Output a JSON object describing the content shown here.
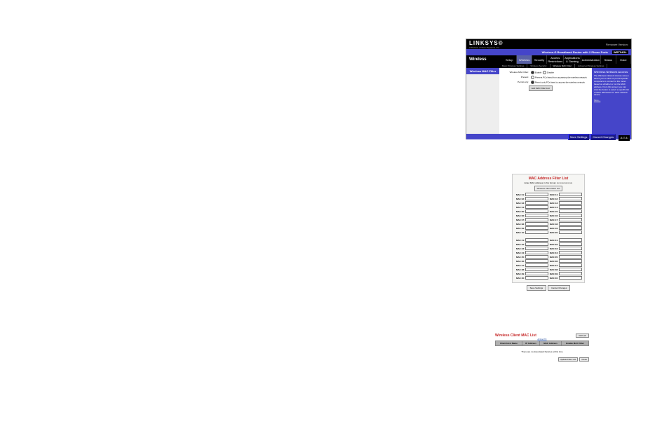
{
  "fig1": {
    "logo": "LINKSYS®",
    "tagline": "A Division of Cisco Systems, Inc.",
    "firmware": "Firmware Version:",
    "router_name": "Wireless-G Broadband Router with 2 Phone Ports",
    "model": "WRT54GL",
    "section": "Wireless",
    "tabs": [
      "Setup",
      "Wireless",
      "Security",
      "Access Restrictions",
      "Applications & Gaming",
      "Administration",
      "Status",
      "Voice"
    ],
    "subtabs": [
      "Basic Wireless Settings",
      "Wireless Security",
      "Wireless MAC Filter",
      "Advanced Wireless Settings"
    ],
    "side_label": "Wireless MAC Filter",
    "row_filter": {
      "label": "Wireless MAC Filter:",
      "opt1": "Enable",
      "opt2": "Disable"
    },
    "row_prevent": {
      "label": "Prevent:",
      "text": "Prevent PCs listed from accessing the wireless network"
    },
    "row_permit": {
      "label": "Permit only:",
      "text": "Permit only PCs listed to access the wireless network"
    },
    "edit_btn": "Edit MAC Filter List",
    "help": {
      "title": "Wireless Network Access",
      "body": "The Wireless Network Access screen allows you to block or permit specific computers to connect to the router based on whether or not the MAC address. From this screen you can click the button to select a specific list of MAC addresses for each network device.",
      "more": "More..."
    },
    "save": "Save Settings",
    "cancel": "Cancel Changes"
  },
  "fig2": {
    "title": "MAC Address Filter List",
    "sub": "Enter MAC Address in this format: xx:xx:xx:xx:xx:xx",
    "wcl": "Wireless Client MAC List",
    "block1": [
      [
        "MAC 01:",
        "MAC 11:"
      ],
      [
        "MAC 02:",
        "MAC 12:"
      ],
      [
        "MAC 03:",
        "MAC 13:"
      ],
      [
        "MAC 04:",
        "MAC 14:"
      ],
      [
        "MAC 05:",
        "MAC 15:"
      ],
      [
        "MAC 06:",
        "MAC 16:"
      ],
      [
        "MAC 07:",
        "MAC 17:"
      ],
      [
        "MAC 08:",
        "MAC 18:"
      ],
      [
        "MAC 09:",
        "MAC 19:"
      ],
      [
        "MAC 10:",
        "MAC 20:"
      ]
    ],
    "block2": [
      [
        "MAC 21:",
        "MAC 31:"
      ],
      [
        "MAC 22:",
        "MAC 32:"
      ],
      [
        "MAC 23:",
        "MAC 33:"
      ],
      [
        "MAC 24:",
        "MAC 34:"
      ],
      [
        "MAC 25:",
        "MAC 35:"
      ],
      [
        "MAC 26:",
        "MAC 36:"
      ],
      [
        "MAC 27:",
        "MAC 37:"
      ],
      [
        "MAC 28:",
        "MAC 38:"
      ],
      [
        "MAC 29:",
        "MAC 39:"
      ],
      [
        "MAC 30:",
        "MAC 40:"
      ]
    ],
    "save": "Save Settings",
    "cancel": "Cancel Changes"
  },
  "fig3": {
    "title": "Wireless Client MAC List",
    "refresh": "Refresh",
    "active": "Active PC",
    "cols": [
      "Client Host Name",
      "IP Address",
      "MAC Address",
      "Enable MAC Filter"
    ],
    "msg": "There are no Associated Devices at this time",
    "update": "Update Filter List",
    "close": "Close"
  }
}
